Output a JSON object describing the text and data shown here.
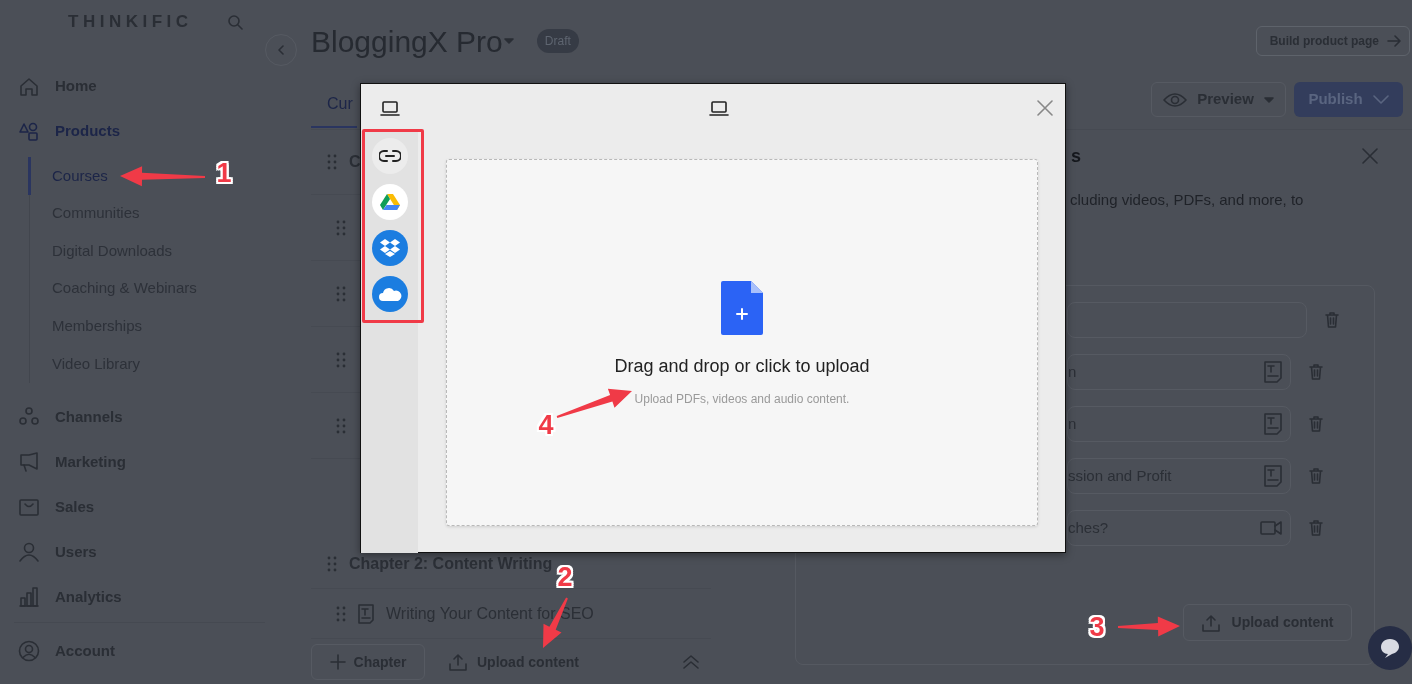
{
  "sidebar": {
    "logo": "THINKIFIC",
    "items": [
      {
        "label": "Home",
        "selected": false
      },
      {
        "label": "Products",
        "selected": true,
        "children": [
          {
            "label": "Courses",
            "selected": true
          },
          {
            "label": "Communities",
            "selected": false
          },
          {
            "label": "Digital Downloads",
            "selected": false
          },
          {
            "label": "Coaching & Webinars",
            "selected": false
          },
          {
            "label": "Memberships",
            "selected": false
          },
          {
            "label": "Video Library",
            "selected": false
          }
        ]
      },
      {
        "label": "Channels",
        "selected": false
      },
      {
        "label": "Marketing",
        "selected": false
      },
      {
        "label": "Sales",
        "selected": false
      },
      {
        "label": "Users",
        "selected": false
      },
      {
        "label": "Analytics",
        "selected": false
      }
    ],
    "account": "Account"
  },
  "header": {
    "title": "BloggingX Pro",
    "status": "Draft",
    "build_button": "Build product page"
  },
  "tabs": [
    {
      "label": "Cur",
      "selected": true
    }
  ],
  "actions": {
    "preview": "Preview",
    "publish": "Publish"
  },
  "curriculum": {
    "rows": [
      {
        "kind": "chapter",
        "title": "C"
      },
      {
        "kind": "lesson"
      },
      {
        "kind": "lesson"
      },
      {
        "kind": "lesson"
      },
      {
        "kind": "lesson"
      },
      {
        "kind": "gap"
      },
      {
        "kind": "chapter",
        "title": "Chapter 2: Content Writing"
      },
      {
        "kind": "lesson",
        "title": "Writing Your Content for SEO"
      }
    ],
    "add_chapter": "Chapter",
    "upload": "Upload content"
  },
  "panel": {
    "title": "s",
    "description": "cluding videos, PDFs, and more, to",
    "fields": [
      {
        "kind": "plain"
      },
      {
        "kind": "text",
        "value": "n"
      },
      {
        "kind": "text",
        "value": "n"
      },
      {
        "kind": "text",
        "value": "ssion and Profit"
      },
      {
        "kind": "video",
        "value": "ches?"
      }
    ],
    "upload": "Upload content"
  },
  "modal": {
    "sources": [
      {
        "kind": "link"
      },
      {
        "kind": "drive"
      },
      {
        "kind": "dropbox"
      },
      {
        "kind": "cloud"
      }
    ],
    "drop_title": "Drag and drop or click to upload",
    "drop_hint": "Upload PDFs, videos and audio content."
  },
  "annotations": [
    {
      "kind": "highlight"
    },
    {
      "kind": "arrow",
      "label": "1"
    },
    {
      "kind": "arrow",
      "label": "2"
    },
    {
      "kind": "arrow",
      "label": "3"
    },
    {
      "kind": "arrow",
      "label": "4"
    }
  ]
}
